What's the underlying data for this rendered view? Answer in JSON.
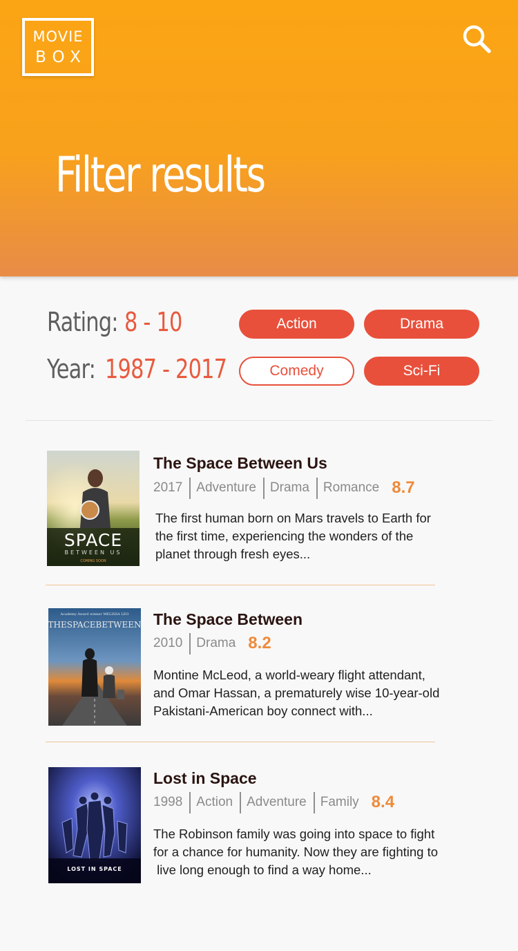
{
  "app": {
    "logo_line1": "MOVIE",
    "logo_line2": "BOX",
    "title": "Filter results"
  },
  "icons": {
    "search": "search-icon"
  },
  "colors": {
    "header_top": "#fba514",
    "header_bottom": "#e88c47",
    "accent": "#e8503b",
    "rating": "#ee8a3a"
  },
  "filters": {
    "rating_label": "Rating:",
    "rating_value": "8 - 10",
    "year_label": "Year:",
    "year_value": "1987 - 2017",
    "genres": [
      {
        "label": "Action",
        "selected": true
      },
      {
        "label": "Drama",
        "selected": true
      },
      {
        "label": "Comedy",
        "selected": false
      },
      {
        "label": "Sci-Fi",
        "selected": true
      }
    ]
  },
  "movies": [
    {
      "title": "The Space Between Us",
      "year": "2017",
      "genres": [
        "Adventure",
        "Drama",
        "Romance"
      ],
      "rating": "8.7",
      "description": [
        "The first human born on Mars travels to Earth for",
        "the first time, experiencing the wonders of the",
        "planet through fresh eyes..."
      ],
      "poster": {
        "title_text": "SPACE",
        "sub_text": "BETWEEN US",
        "credit_text": "COMING SOON"
      }
    },
    {
      "title": "The Space Between",
      "year": "2010",
      "genres": [
        "Drama"
      ],
      "rating": "8.2",
      "description": [
        "Montine McLeod, a world-weary flight attendant,",
        "and Omar Hassan, a prematurely wise 10-year-old",
        "Pakistani-American boy connect with..."
      ],
      "poster": {
        "title_text": "THESPACEBETWEEN",
        "top_text": "Academy Award winner MELISSA LEO"
      }
    },
    {
      "title": "Lost in Space",
      "year": "1998",
      "genres": [
        "Action",
        "Adventure",
        "Family"
      ],
      "rating": "8.4",
      "description": [
        "The Robinson family was going into space to fight",
        "for a chance for humanity. Now they are fighting to",
        " live long enough to find a way home..."
      ],
      "poster": {
        "title_text": "LOST IN SPACE"
      }
    }
  ]
}
